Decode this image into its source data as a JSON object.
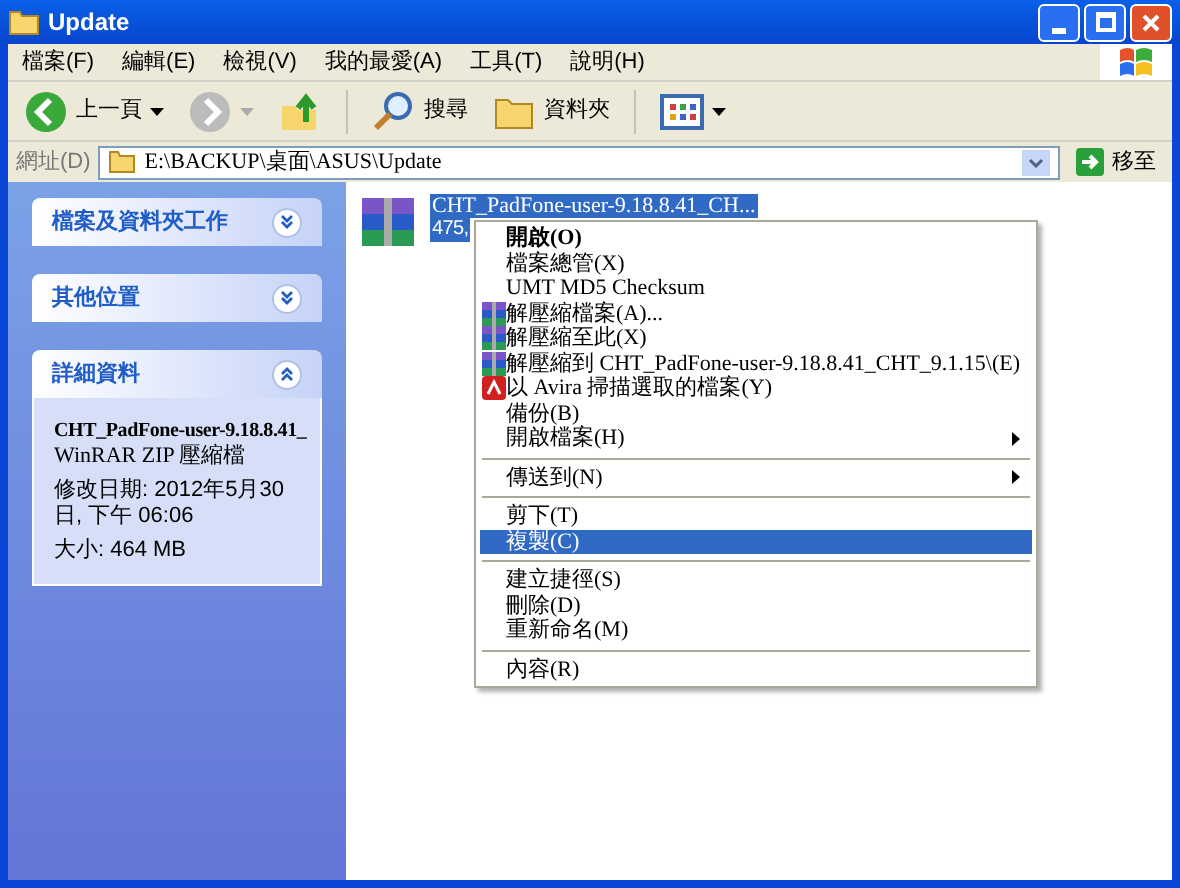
{
  "window": {
    "title": "Update"
  },
  "menu_bar": [
    "檔案(F)",
    "編輯(E)",
    "檢視(V)",
    "我的最愛(A)",
    "工具(T)",
    "說明(H)"
  ],
  "toolbar": [
    {
      "kind": "back",
      "label": "上一頁"
    },
    {
      "kind": "forward"
    },
    {
      "kind": "up"
    },
    {
      "kind": "search",
      "label": "搜尋"
    },
    {
      "kind": "folders",
      "label": "資料夾"
    },
    {
      "kind": "views"
    }
  ],
  "address_bar": {
    "label": "網址(D)",
    "value": "E:\\BACKUP\\桌面\\ASUS\\Update",
    "go": "移至"
  },
  "sidebar": [
    {
      "title": "檔案及資料夾工作",
      "expanded": false
    },
    {
      "title": "其他位置",
      "expanded": false
    },
    {
      "title": "詳細資料",
      "expanded": true,
      "details": {
        "name": "CHT_PadFone-user-9.18.8.41_",
        "type": "WinRAR ZIP 壓縮檔",
        "modified": "修改日期: 2012年5月30日, 下午 06:06",
        "size": "大小: 464 MB"
      }
    }
  ],
  "file": {
    "name": "CHT_PadFone-user-9.18.8.41_CH...",
    "size": "475,",
    "selected": true
  },
  "context_menu": [
    {
      "kind": "item",
      "label": "開啟(O)",
      "bold": true,
      "selected": false
    },
    {
      "kind": "item",
      "label": "檔案總管(X)",
      "selected": false
    },
    {
      "kind": "item",
      "label": "UMT MD5 Checksum",
      "selected": false
    },
    {
      "kind": "archive",
      "label": "解壓縮檔案(A)...",
      "selected": false
    },
    {
      "kind": "archive",
      "label": "解壓縮至此(X)",
      "selected": false
    },
    {
      "kind": "archive",
      "label": "解壓縮到 CHT_PadFone-user-9.18.8.41_CHT_9.1.15\\(E)",
      "selected": false
    },
    {
      "kind": "avira",
      "label": "以 Avira 掃描選取的檔案(Y)",
      "selected": false
    },
    {
      "kind": "item",
      "label": "備份(B)",
      "selected": false
    },
    {
      "kind": "item",
      "label": "開啟檔案(H)",
      "submenu": true,
      "selected": false
    },
    {
      "kind": "separator"
    },
    {
      "kind": "item",
      "label": "傳送到(N)",
      "submenu": true,
      "selected": false
    },
    {
      "kind": "separator"
    },
    {
      "kind": "item",
      "label": "剪下(T)",
      "selected": false
    },
    {
      "kind": "item",
      "label": "複製(C)",
      "selected": true
    },
    {
      "kind": "separator"
    },
    {
      "kind": "item",
      "label": "建立捷徑(S)",
      "selected": false
    },
    {
      "kind": "item",
      "label": "刪除(D)",
      "selected": false
    },
    {
      "kind": "item",
      "label": "重新命名(M)",
      "selected": false
    },
    {
      "kind": "separator"
    },
    {
      "kind": "item",
      "label": "內容(R)",
      "selected": false
    }
  ]
}
